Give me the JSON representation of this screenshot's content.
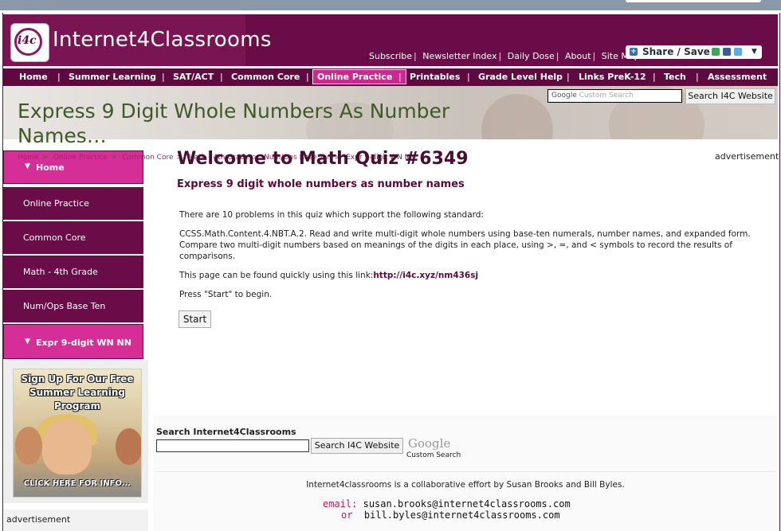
{
  "site": {
    "name": "Internet4Classrooms",
    "logo_text": "i4c",
    "top_links": [
      "Subscribe",
      "Newsletter Index",
      "Daily Dose",
      "About",
      "Site Map"
    ],
    "share_label": "Share / Save"
  },
  "nav": {
    "items": [
      "Home",
      "Summer Learning",
      "SAT/ACT",
      "Common Core",
      "Online Practice",
      "Printables",
      "Grade Level Help",
      "Links PreK-12",
      "Tech",
      "Assessment"
    ],
    "active": "Online Practice"
  },
  "banner": {
    "title": "Express 9 Digit Whole Numbers As Number Names…",
    "search_placeholder": "Custom Search",
    "search_brand": "Google",
    "search_button": "Search I4C Website"
  },
  "breadcrumb": [
    "Home",
    "Online Practice",
    "Common Core",
    "Math - 4th Grade",
    "Num/Ops Base Ten",
    "Expr 9-digit WN NN"
  ],
  "sidebar": {
    "items": [
      "Home",
      "Online Practice",
      "Common Core",
      "Math - 4th Grade",
      "Num/Ops Base Ten",
      "Expr 9-digit WN NN"
    ],
    "promo_head": "Sign Up For Our Free Summer Learning Program",
    "promo_foot": "CLICK HERE FOR INFO...",
    "ad_label": "advertisement"
  },
  "main": {
    "title": "Welcome to Math Quiz #6349",
    "subtitle": "Express 9 digit whole numbers as number names",
    "ad_label": "advertisement",
    "intro": "There are 10 problems in this quiz which support the following standard:",
    "standard": "CCSS.Math.Content.4.NBT.A.2. Read and write multi-digit whole numbers using base-ten numerals, number names, and expanded form. Compare two multi-digit numbers based on meanings of the digits in each place, using >, =, and < symbols to record the results of comparisons.",
    "link_prefix": "This page can be found quickly using this link:",
    "link": "http://i4c.xyz/nm436sj",
    "press_start": "Press \"Start\" to begin.",
    "start_button": "Start"
  },
  "footer": {
    "search_label": "Search Internet4Classrooms",
    "search_button": "Search I4C Website",
    "google_logo": "Google",
    "google_sub": "Custom Search",
    "collab": "Internet4classrooms is a collaborative effort by Susan Brooks and Bill Byles.",
    "email_label": "email:",
    "email1": "susan.brooks@internet4classrooms.com",
    "or_label": "or",
    "email2": "bill.byles@internet4classrooms.com"
  },
  "colors": {
    "brand": "#6a0c47",
    "accent": "#d52f97",
    "banner_title": "#3f5a26"
  }
}
